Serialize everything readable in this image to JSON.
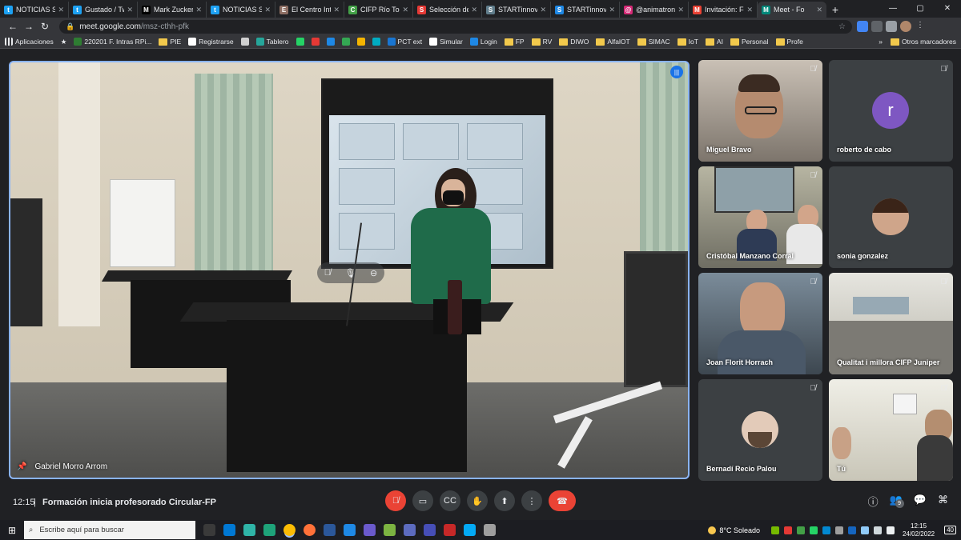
{
  "browser": {
    "tabs": [
      {
        "title": "NOTICIAS Sal",
        "color": "#1da1f2",
        "glyph": "t"
      },
      {
        "title": "Gustado / Tw",
        "color": "#1da1f2",
        "glyph": "t"
      },
      {
        "title": "Mark Zuckerb",
        "color": "#000000",
        "glyph": "M"
      },
      {
        "title": "NOTICIAS Sal",
        "color": "#1da1f2",
        "glyph": "t"
      },
      {
        "title": "El Centro Inte",
        "color": "#8d6e63",
        "glyph": "E"
      },
      {
        "title": "CIFP Río Torm",
        "color": "#43a047",
        "glyph": "C"
      },
      {
        "title": "Selección de",
        "color": "#e53935",
        "glyph": "S"
      },
      {
        "title": "STARTinnova",
        "color": "#607d8b",
        "glyph": "S"
      },
      {
        "title": "STARTinnova",
        "color": "#1e88e5",
        "glyph": "S"
      },
      {
        "title": "@animatroni",
        "color": "#d62976",
        "glyph": "@"
      },
      {
        "title": "Invitación: Fo",
        "color": "#ea4335",
        "glyph": "M"
      },
      {
        "title": "Meet - Fo",
        "color": "#00897b",
        "glyph": "M"
      }
    ],
    "new_tab": "+",
    "window_controls": [
      "—",
      "▢",
      "✕"
    ],
    "address": {
      "host": "meet.google.com",
      "path": "/msz-cthh-pfk"
    },
    "bookmarks": [
      {
        "label": "Aplicaciones",
        "kind": "apps"
      },
      {
        "label": "",
        "kind": "star"
      },
      {
        "label": "220201 F. Intras RPi...",
        "kind": "icon",
        "color": "#2e7d32"
      },
      {
        "label": "PIE",
        "kind": "folder"
      },
      {
        "label": "Registrarse",
        "kind": "icon",
        "color": "#ffffff"
      },
      {
        "label": "",
        "kind": "icon",
        "color": "#d0d0d0"
      },
      {
        "label": "Tablero",
        "kind": "icon",
        "color": "#26a69a"
      },
      {
        "label": "",
        "kind": "icon",
        "color": "#25d366"
      },
      {
        "label": "",
        "kind": "icon",
        "color": "#e53935"
      },
      {
        "label": "",
        "kind": "icon",
        "color": "#1e88e5"
      },
      {
        "label": "",
        "kind": "icon",
        "color": "#34a853"
      },
      {
        "label": "",
        "kind": "icon",
        "color": "#f4b400"
      },
      {
        "label": "",
        "kind": "icon",
        "color": "#00acc1"
      },
      {
        "label": "PCT ext",
        "kind": "icon",
        "color": "#1976d2"
      },
      {
        "label": "Simular",
        "kind": "icon",
        "color": "#ffffff"
      },
      {
        "label": "Login",
        "kind": "icon",
        "color": "#1e88e5"
      },
      {
        "label": "FP",
        "kind": "folder"
      },
      {
        "label": "RV",
        "kind": "folder"
      },
      {
        "label": "DIWO",
        "kind": "folder"
      },
      {
        "label": "AlfalOT",
        "kind": "folder"
      },
      {
        "label": "SIMAC",
        "kind": "folder"
      },
      {
        "label": "IoT",
        "kind": "folder"
      },
      {
        "label": "AI",
        "kind": "folder"
      },
      {
        "label": "Personal",
        "kind": "folder"
      },
      {
        "label": "Profe",
        "kind": "folder"
      }
    ],
    "bookmarks_more": "»",
    "other_bookmarks": "Otros marcadores"
  },
  "meet": {
    "main_speaker": "Gabriel Morro Arrom",
    "participants": [
      {
        "name": "Miguel Bravo",
        "kind": "video"
      },
      {
        "name": "roberto de cabo",
        "kind": "letter",
        "letter": "r"
      },
      {
        "name": "Cristóbal Manzano Corral",
        "kind": "video"
      },
      {
        "name": "sonia gonzalez",
        "kind": "photo"
      },
      {
        "name": "Joan Florit Horrach",
        "kind": "video"
      },
      {
        "name": "Qualitat i millora CIFP Juniper",
        "kind": "video"
      },
      {
        "name": "Bernadí Recio Palou",
        "kind": "photo"
      },
      {
        "name": "Tú",
        "kind": "video"
      }
    ],
    "bar": {
      "time": "12:15",
      "separator": "|",
      "title": "Formación inicia profesorado Circular-FP",
      "participant_count": "9"
    }
  },
  "taskbar": {
    "search_placeholder": "Escribe aquí para buscar",
    "weather": "8°C  Soleado",
    "clock_time": "12:15",
    "clock_date": "24/02/2022",
    "notifications": "40"
  }
}
